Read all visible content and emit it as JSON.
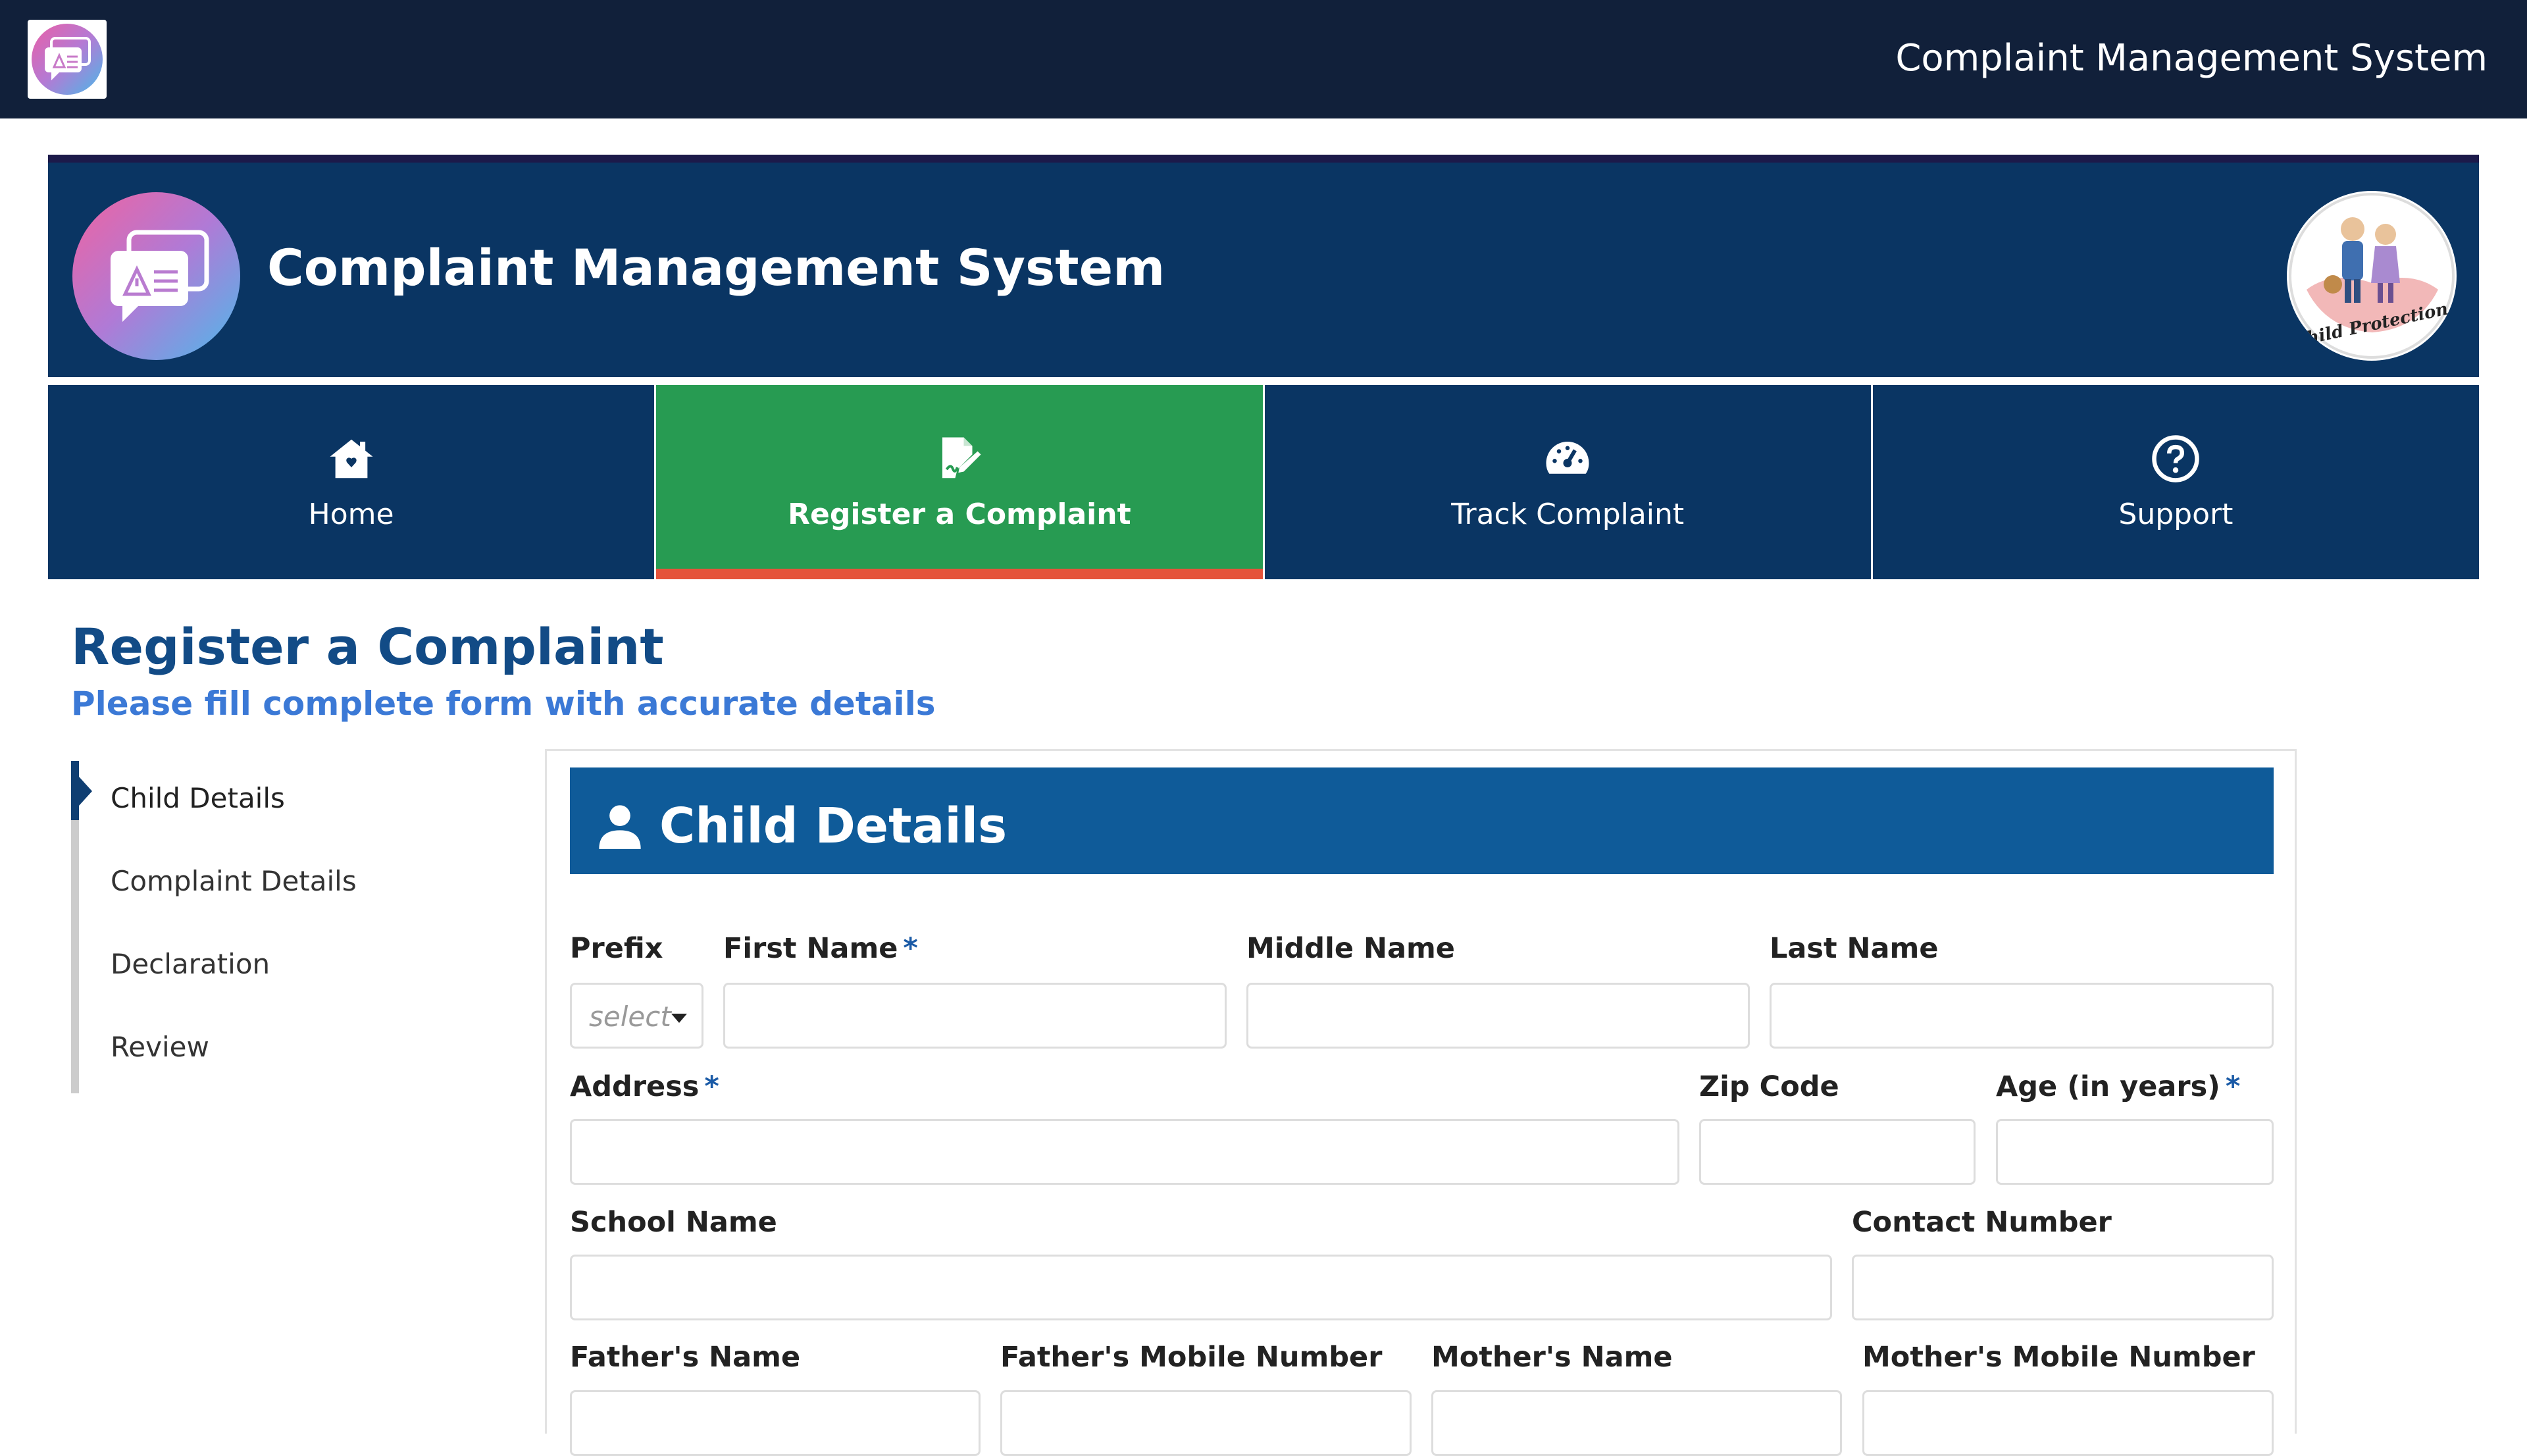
{
  "topbar": {
    "title": "Complaint Management System"
  },
  "banner": {
    "title": "Complaint Management System",
    "child_logo_text": "Child Protection"
  },
  "nav": {
    "tabs": [
      {
        "label": "Home",
        "icon": "home-icon",
        "active": false
      },
      {
        "label": "Register a Complaint",
        "icon": "edit-document-icon",
        "active": true
      },
      {
        "label": "Track Complaint",
        "icon": "speedometer-icon",
        "active": false
      },
      {
        "label": "Support",
        "icon": "question-circle-icon",
        "active": false
      }
    ]
  },
  "page": {
    "title": "Register a Complaint",
    "subtitle": "Please fill complete form with accurate details"
  },
  "steps": [
    {
      "label": "Child Details",
      "active": true
    },
    {
      "label": "Complaint Details",
      "active": false
    },
    {
      "label": "Declaration",
      "active": false
    },
    {
      "label": "Review",
      "active": false
    }
  ],
  "form": {
    "section_title": "Child Details",
    "required_mark": "*",
    "prefix": {
      "label": "Prefix",
      "value": "select"
    },
    "first_name": {
      "label": "First Name",
      "value": "",
      "required": true
    },
    "middle_name": {
      "label": "Middle Name",
      "value": ""
    },
    "last_name": {
      "label": "Last Name",
      "value": ""
    },
    "address": {
      "label": "Address",
      "value": "",
      "required": true
    },
    "zip_code": {
      "label": "Zip Code",
      "value": ""
    },
    "age": {
      "label": "Age (in years)",
      "value": "",
      "required": true
    },
    "school_name": {
      "label": "School Name",
      "value": ""
    },
    "contact_number": {
      "label": "Contact Number",
      "value": ""
    },
    "father_name": {
      "label": "Father's Name",
      "value": ""
    },
    "father_mobile": {
      "label": "Father's Mobile Number",
      "value": ""
    },
    "mother_name": {
      "label": "Mother's Name",
      "value": ""
    },
    "mother_mobile": {
      "label": "Mother's Mobile Number",
      "value": ""
    }
  },
  "colors": {
    "topbar": "#11203a",
    "banner": "#0a3563",
    "active_tab": "#279b52",
    "active_tab_underline": "#e5533a",
    "section_header": "#0f5b99",
    "heading": "#124b86",
    "subheading": "#3b79d6"
  }
}
